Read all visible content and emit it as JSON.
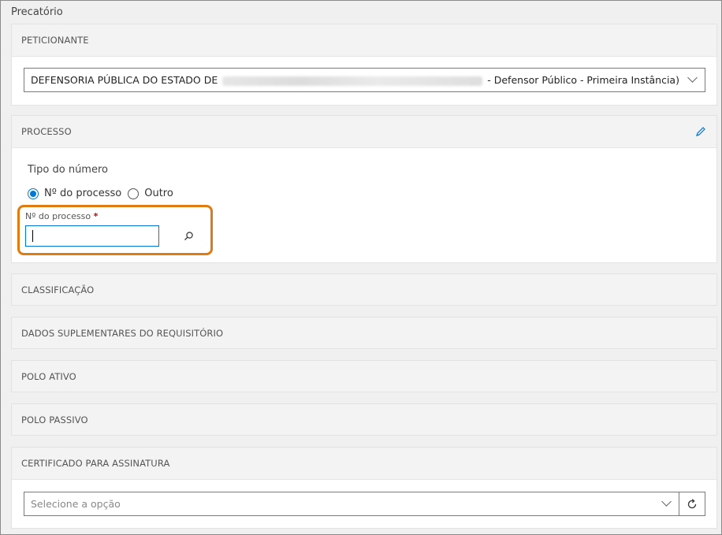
{
  "page": {
    "title": "Precatório"
  },
  "peticionante": {
    "header": "PETICIONANTE",
    "select_prefix": "DEFENSORIA PÚBLICA DO ESTADO DE",
    "select_suffix": "- Defensor Público - Primeira Instância)"
  },
  "processo": {
    "header": "PROCESSO",
    "tipo_label": "Tipo do número",
    "radio_options": [
      "Nº do processo",
      "Outro"
    ],
    "selected_option": "Nº do processo",
    "field_label": "Nº do processo",
    "required_mark": "*",
    "field_value": ""
  },
  "sections": {
    "classificacao": "CLASSIFICAÇÃO",
    "dados_suplementares": "DADOS SUPLEMENTARES DO REQUISITÓRIO",
    "polo_ativo": "POLO ATIVO",
    "polo_passivo": "POLO PASSIVO"
  },
  "certificado": {
    "header": "CERTIFICADO PARA ASSINATURA",
    "placeholder": "Selecione a opção"
  },
  "colors": {
    "accent": "#0078d4",
    "highlight": "#e07b12",
    "required": "#cc0000"
  },
  "icons": {
    "edit": "pencil-icon",
    "search": "search-icon",
    "refresh": "refresh-icon",
    "dropdown": "chevron-down-icon"
  }
}
